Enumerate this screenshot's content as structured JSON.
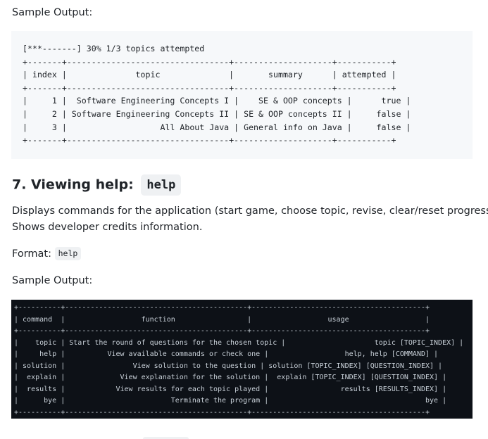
{
  "sample_label_1": "Sample Output:",
  "progress_output": [
    "[***-------] 30% 1/3 topics attempted",
    "+-------+---------------------------------+--------------------+-----------+",
    "| index |              topic              |       summary      | attempted |",
    "+-------+---------------------------------+--------------------+-----------+",
    "|     1 |  Software Engineering Concepts I |    SE & OOP concepts |      true |",
    "|     2 | Software Engineering Concepts II | SE & OOP concepts II |     false |",
    "|     3 |                   All About Java | General info on Java |     false |",
    "+-------+---------------------------------+--------------------+-----------+"
  ],
  "section": {
    "title": "7. Viewing help:",
    "command": "help",
    "description": [
      "Displays commands for the application (start game, choose topic, revise, clear/reset progress).",
      "Shows developer credits information."
    ],
    "format_label": "Format:",
    "format_code": "help",
    "sample_label": "Sample Output:"
  },
  "help_output": [
    "+----------+-------------------------------------------+-----------------------------------------+",
    "| command  |                  function                 |                  usage                  |",
    "+----------+-------------------------------------------+-----------------------------------------+",
    "|    topic | Start the round of questions for the chosen topic |                     topic [TOPIC_INDEX] |",
    "|     help |          View available commands or check one |                  help, help [COMMAND] |",
    "| solution |                View solution to the question | solution [TOPIC_INDEX] [QUESTION_INDEX] |",
    "|  explain |             View explanation for the solution |  explain [TOPIC_INDEX] [QUESTION_INDEX] |",
    "|  results |            View results for each topic played |                 results [RESULTS_INDEX] |",
    "|      bye |                         Terminate the program |                                     bye |",
    "+----------+-------------------------------------------+-----------------------------------------+"
  ]
}
